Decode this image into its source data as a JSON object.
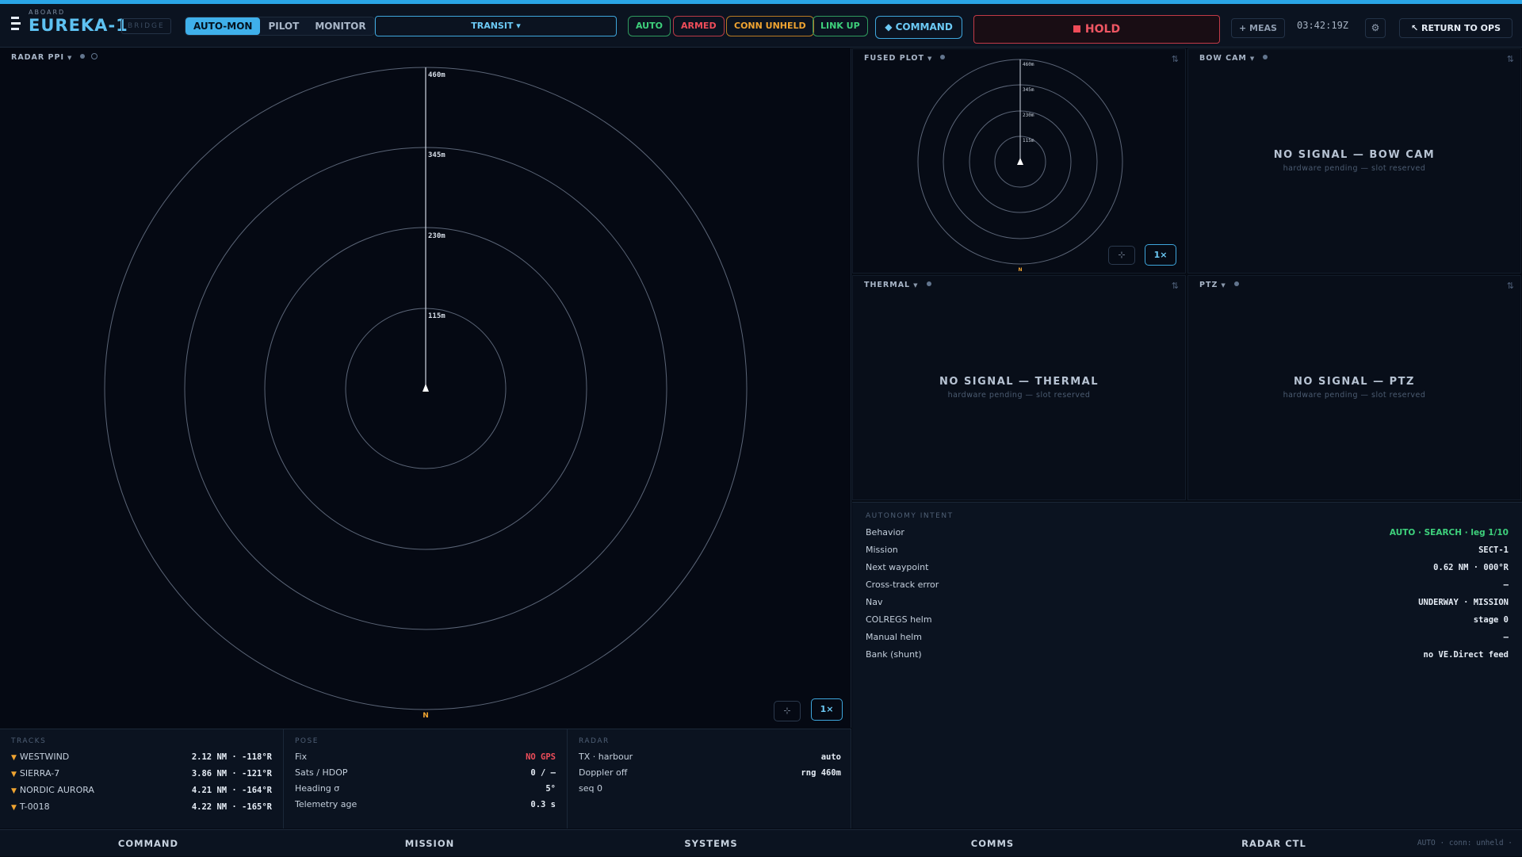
{
  "header": {
    "brand_small": "ABOARD",
    "brand_title": "EUREKA-1",
    "bridge": "BRIDGE",
    "modes": [
      "AUTO-MON",
      "PILOT",
      "MONITOR"
    ],
    "active_mode": "AUTO-MON",
    "transit": "TRANSIT ▾",
    "status_pills": {
      "auto": "AUTO",
      "armed": "ARMED",
      "conn": "CONN UNHELD",
      "link": "LINK UP"
    },
    "command": "◆ COMMAND",
    "hold": "HOLD",
    "meas": "+ MEAS",
    "clock": "03:42:19Z",
    "settings_icon": "⚙",
    "return": "↖ RETURN TO OPS"
  },
  "radar": {
    "title": "RADAR PPI",
    "rings": [
      "115m",
      "230m",
      "345m",
      "460m"
    ],
    "north": "N",
    "zoom": "1×",
    "recenter_icon": "⊹"
  },
  "fused": {
    "title": "FUSED PLOT",
    "rings": [
      "115m",
      "230m",
      "345m",
      "460m"
    ],
    "north": "N",
    "zoom": "1×",
    "recenter_icon": "⊹"
  },
  "tiles": {
    "bow": {
      "title": "BOW CAM",
      "nosig": "NO SIGNAL — BOW CAM",
      "sub": "hardware pending — slot reserved"
    },
    "thermal": {
      "title": "THERMAL",
      "nosig": "NO SIGNAL — THERMAL",
      "sub": "hardware pending — slot reserved"
    },
    "ptz": {
      "title": "PTZ",
      "nosig": "NO SIGNAL — PTZ",
      "sub": "hardware pending — slot reserved"
    },
    "swap_icon": "⇅"
  },
  "intent": {
    "header": "AUTONOMY INTENT",
    "rows": [
      {
        "k": "Behavior",
        "v": "AUTO · SEARCH · leg 1/10"
      },
      {
        "k": "Mission",
        "v": "SECT-1"
      },
      {
        "k": "Next waypoint",
        "v": "0.62 NM · 000°R"
      },
      {
        "k": "Cross-track error",
        "v": "—"
      },
      {
        "k": "Nav",
        "v": "UNDERWAY · MISSION"
      },
      {
        "k": "COLREGS helm",
        "v": "stage 0"
      },
      {
        "k": "Manual helm",
        "v": "—"
      },
      {
        "k": "Bank (shunt)",
        "v": "no VE.Direct feed"
      }
    ]
  },
  "tracks": {
    "header": "TRACKS",
    "rows": [
      {
        "k": "WESTWIND",
        "v": "2.12 NM · -118°R"
      },
      {
        "k": "SIERRA-7",
        "v": "3.86 NM · -121°R"
      },
      {
        "k": "NORDIC AURORA",
        "v": "4.21 NM · -164°R"
      },
      {
        "k": "T-0018",
        "v": "4.22 NM · -165°R"
      }
    ]
  },
  "pose": {
    "header": "POSE",
    "rows": [
      {
        "k": "Fix",
        "v": "NO GPS"
      },
      {
        "k": "Sats / HDOP",
        "v": "0 / —"
      },
      {
        "k": "Heading σ",
        "v": "5°"
      },
      {
        "k": "Telemetry age",
        "v": "0.3 s"
      }
    ]
  },
  "radar_info": {
    "header": "RADAR",
    "rows": [
      {
        "k": "TX · harbour",
        "v": "auto"
      },
      {
        "k": "Doppler off",
        "v": "rng 460m"
      },
      {
        "k": "seq 0",
        "v": ""
      }
    ]
  },
  "nav": {
    "tabs": [
      "COMMAND",
      "MISSION",
      "SYSTEMS",
      "COMMS",
      "RADAR CTL"
    ],
    "status": "AUTO · conn: unheld ·"
  },
  "colors": {
    "accent": "#3fb0ea",
    "ok": "#3ed17c",
    "alarm": "#ee4d5a",
    "warn": "#f0a431",
    "background": "#060b14"
  }
}
